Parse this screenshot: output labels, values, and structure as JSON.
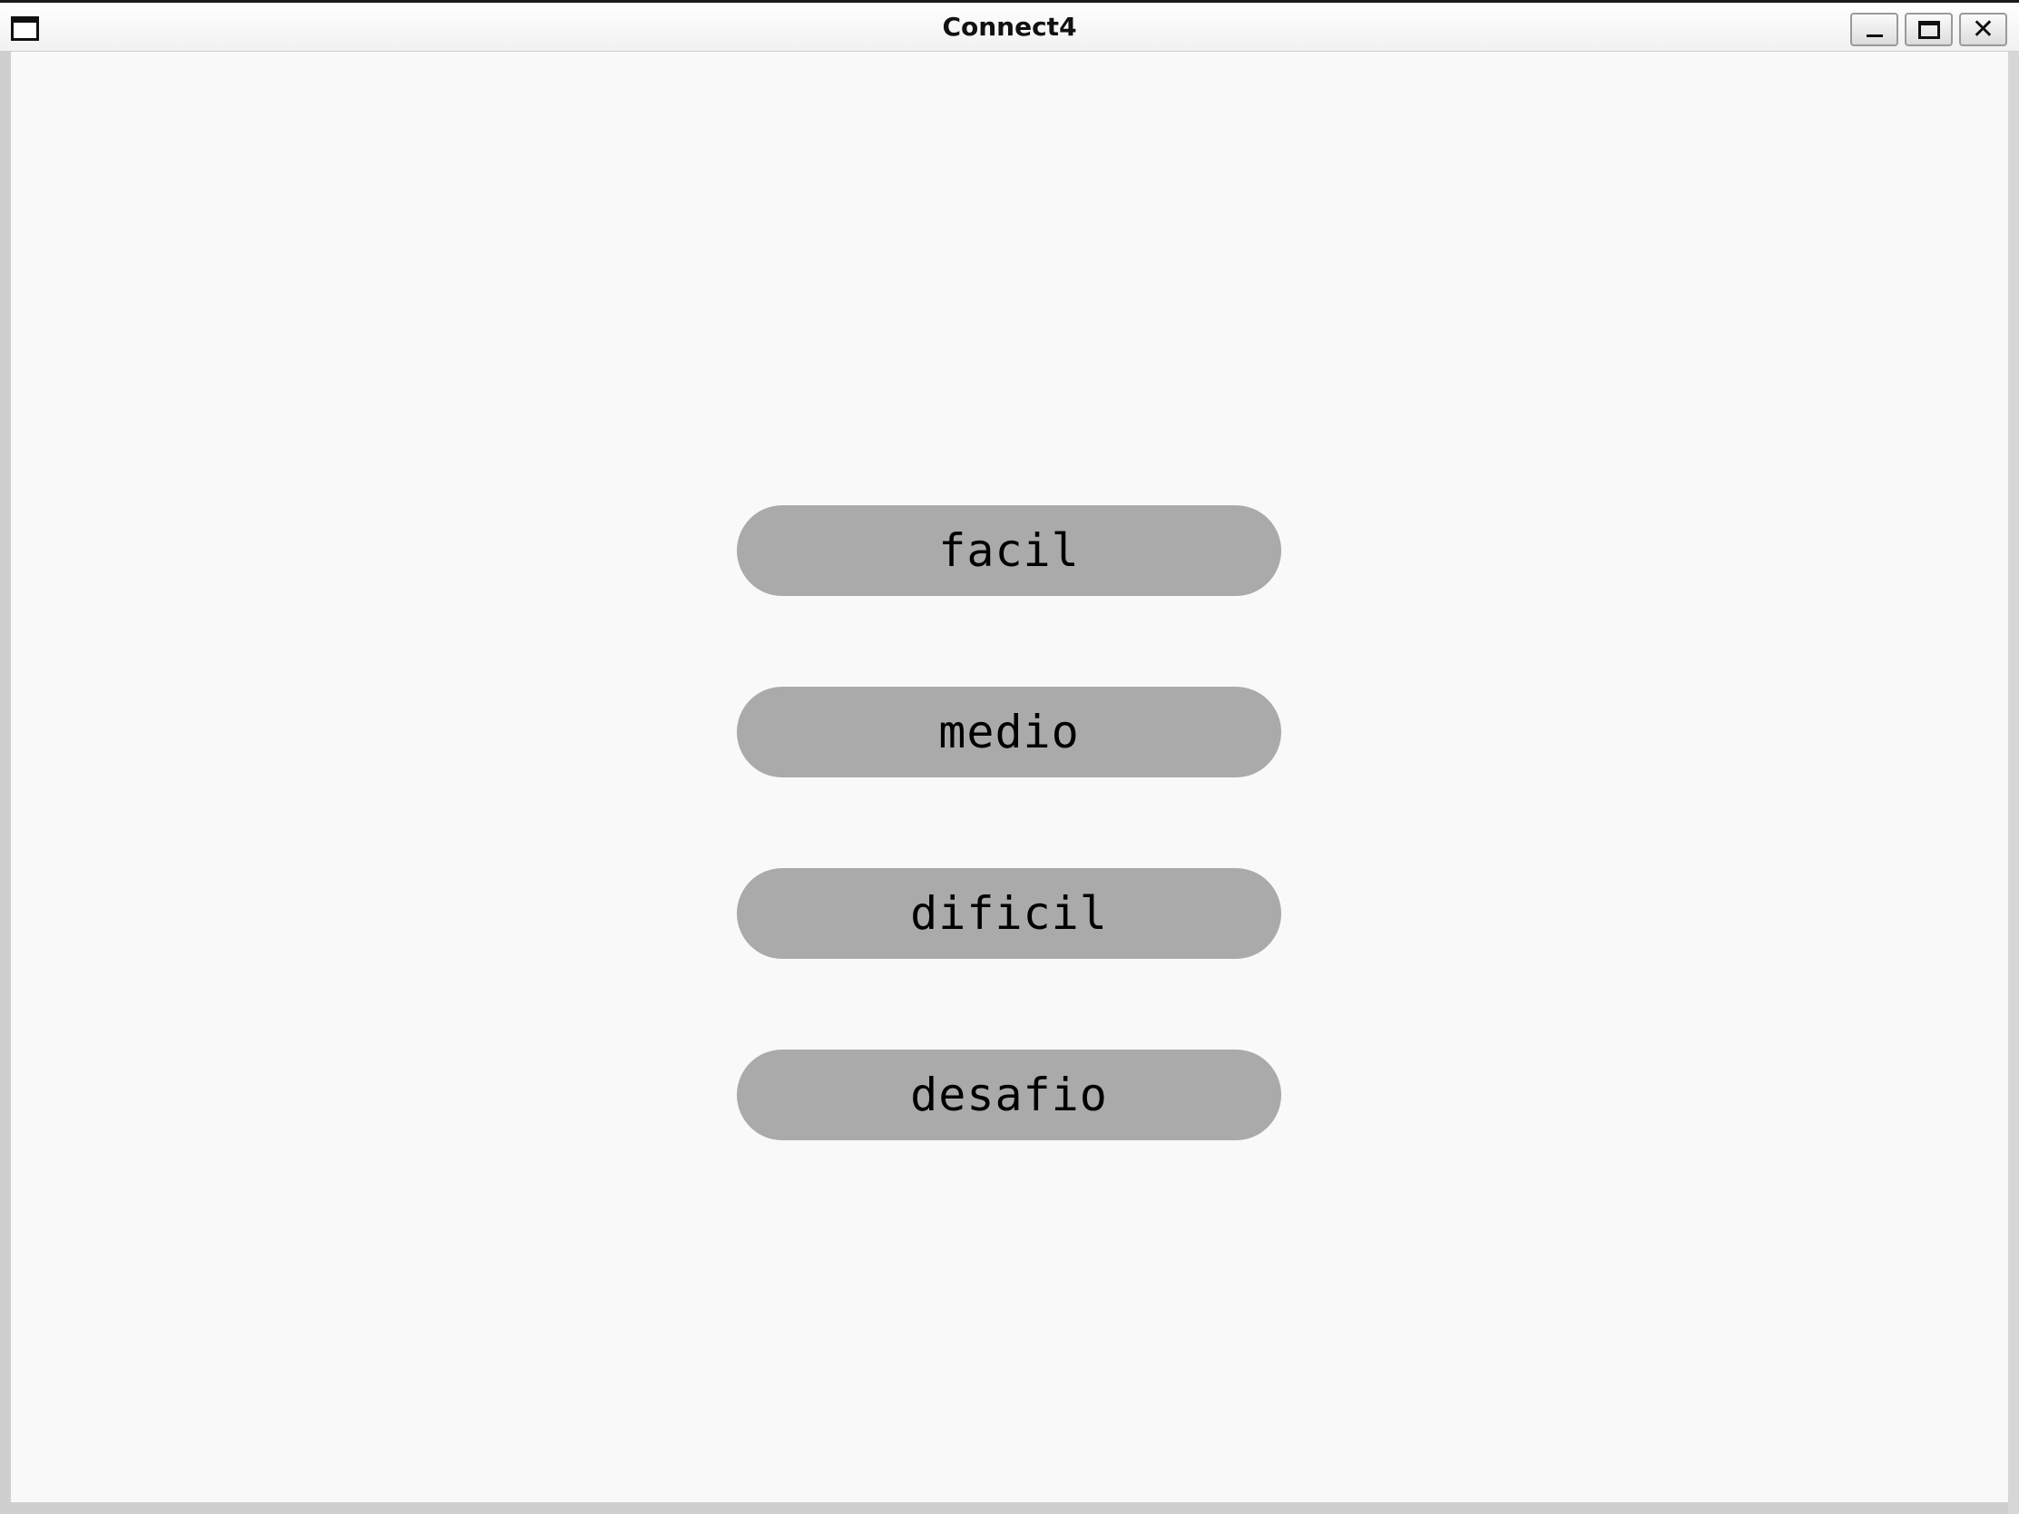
{
  "window": {
    "title": "Connect4",
    "controls": {
      "minimize_icon": "minimize-icon",
      "maximize_icon": "maximize-icon",
      "close_icon": "close-icon",
      "close_glyph": "✕"
    }
  },
  "menu": {
    "buttons": [
      {
        "label": "facil"
      },
      {
        "label": "medio"
      },
      {
        "label": "dificil"
      },
      {
        "label": "desafio"
      }
    ]
  },
  "colors": {
    "background": "#f9f9f9",
    "button_fill": "#aaaaaa",
    "text": "#000000"
  }
}
